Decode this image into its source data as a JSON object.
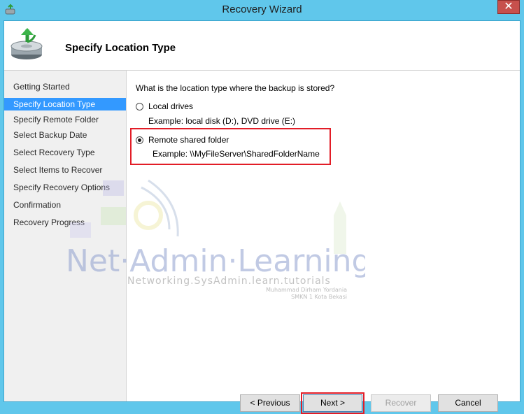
{
  "window": {
    "title": "Recovery Wizard",
    "close_glyph": "✕"
  },
  "header": {
    "title": "Specify Location Type"
  },
  "steps": [
    {
      "label": "Getting Started",
      "active": false
    },
    {
      "label": "Specify Location Type",
      "active": true
    },
    {
      "label": "Specify Remote Folder",
      "active": false
    },
    {
      "label": "Select Backup Date",
      "active": false
    },
    {
      "label": "Select Recovery Type",
      "active": false
    },
    {
      "label": "Select Items to Recover",
      "active": false
    },
    {
      "label": "Specify Recovery Options",
      "active": false
    },
    {
      "label": "Confirmation",
      "active": false
    },
    {
      "label": "Recovery Progress",
      "active": false
    }
  ],
  "content": {
    "question": "What is the location type where the backup is stored?",
    "options": [
      {
        "label": "Local drives",
        "example": "Example: local disk (D:), DVD drive (E:)",
        "selected": false
      },
      {
        "label": "Remote shared folder",
        "example": "Example: \\\\MyFileServer\\SharedFolderName",
        "selected": true
      }
    ]
  },
  "watermark": {
    "brand": "Net·Admin·Learning",
    "tagline": "Networking.SysAdmin.learn.tutorials",
    "author": "Muhammad Dirham Yordania",
    "school": "SMKN 1 Kota Bekasi"
  },
  "buttons": {
    "previous": "< Previous",
    "next": "Next >",
    "recover": "Recover",
    "cancel": "Cancel"
  },
  "colors": {
    "accent": "#3399ff",
    "highlight": "#e21d27",
    "frame": "#60c7eb"
  }
}
